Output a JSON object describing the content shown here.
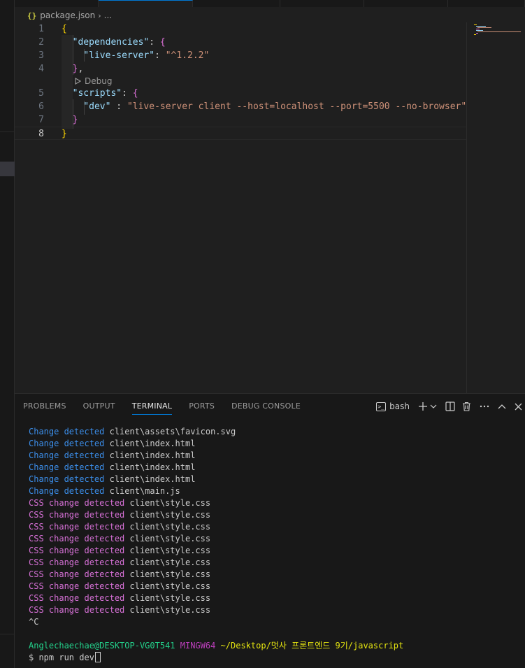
{
  "breadcrumb": {
    "file": "package.json",
    "icon": "{}",
    "more": "..."
  },
  "editor": {
    "codelens": "Debug",
    "lines": [
      {
        "n": "1",
        "tokens": [
          {
            "t": "{",
            "c": "t-brace-y"
          }
        ]
      },
      {
        "n": "2",
        "tokens": [
          {
            "t": "  \"dependencies\"",
            "c": "t-key"
          },
          {
            "t": ": ",
            "c": "t-punc"
          },
          {
            "t": "{",
            "c": "t-brace-p"
          }
        ]
      },
      {
        "n": "3",
        "tokens": [
          {
            "t": "    \"live-server\"",
            "c": "t-key"
          },
          {
            "t": ": ",
            "c": "t-punc"
          },
          {
            "t": "\"^1.2.2\"",
            "c": "t-str"
          }
        ]
      },
      {
        "n": "4",
        "tokens": [
          {
            "t": "  }",
            "c": "t-brace-p"
          },
          {
            "t": ",",
            "c": "t-punc"
          }
        ]
      },
      {
        "n": "5",
        "tokens": [
          {
            "t": "  \"scripts\"",
            "c": "t-key"
          },
          {
            "t": ": ",
            "c": "t-punc"
          },
          {
            "t": "{",
            "c": "t-brace-p"
          }
        ]
      },
      {
        "n": "6",
        "tokens": [
          {
            "t": "    \"dev\"",
            "c": "t-key"
          },
          {
            "t": " : ",
            "c": "t-punc"
          },
          {
            "t": "\"live-server client --host=localhost --port=5500 --no-browser\"",
            "c": "t-str"
          }
        ]
      },
      {
        "n": "7",
        "tokens": [
          {
            "t": "  }",
            "c": "t-brace-p"
          }
        ]
      },
      {
        "n": "8",
        "tokens": [
          {
            "t": "}",
            "c": "t-brace-y"
          }
        ]
      }
    ]
  },
  "panel": {
    "tabs": [
      "PROBLEMS",
      "OUTPUT",
      "TERMINAL",
      "PORTS",
      "DEBUG CONSOLE"
    ],
    "active_tab": "TERMINAL",
    "terminal_name": "bash"
  },
  "terminal": {
    "lines": [
      [
        {
          "t": "Change detected ",
          "c": "c-blue"
        },
        {
          "t": "client\\assets\\favicon.svg",
          "c": "c-white"
        }
      ],
      [
        {
          "t": "Change detected ",
          "c": "c-blue"
        },
        {
          "t": "client\\index.html",
          "c": "c-white"
        }
      ],
      [
        {
          "t": "Change detected ",
          "c": "c-blue"
        },
        {
          "t": "client\\index.html",
          "c": "c-white"
        }
      ],
      [
        {
          "t": "Change detected ",
          "c": "c-blue"
        },
        {
          "t": "client\\index.html",
          "c": "c-white"
        }
      ],
      [
        {
          "t": "Change detected ",
          "c": "c-blue"
        },
        {
          "t": "client\\index.html",
          "c": "c-white"
        }
      ],
      [
        {
          "t": "Change detected ",
          "c": "c-blue"
        },
        {
          "t": "client\\main.js",
          "c": "c-white"
        }
      ],
      [
        {
          "t": "CSS change detected ",
          "c": "c-mag"
        },
        {
          "t": "client\\style.css",
          "c": "c-white"
        }
      ],
      [
        {
          "t": "CSS change detected ",
          "c": "c-mag"
        },
        {
          "t": "client\\style.css",
          "c": "c-white"
        }
      ],
      [
        {
          "t": "CSS change detected ",
          "c": "c-mag"
        },
        {
          "t": "client\\style.css",
          "c": "c-white"
        }
      ],
      [
        {
          "t": "CSS change detected ",
          "c": "c-mag"
        },
        {
          "t": "client\\style.css",
          "c": "c-white"
        }
      ],
      [
        {
          "t": "CSS change detected ",
          "c": "c-mag"
        },
        {
          "t": "client\\style.css",
          "c": "c-white"
        }
      ],
      [
        {
          "t": "CSS change detected ",
          "c": "c-mag"
        },
        {
          "t": "client\\style.css",
          "c": "c-white"
        }
      ],
      [
        {
          "t": "CSS change detected ",
          "c": "c-mag"
        },
        {
          "t": "client\\style.css",
          "c": "c-white"
        }
      ],
      [
        {
          "t": "CSS change detected ",
          "c": "c-mag"
        },
        {
          "t": "client\\style.css",
          "c": "c-white"
        }
      ],
      [
        {
          "t": "CSS change detected ",
          "c": "c-mag"
        },
        {
          "t": "client\\style.css",
          "c": "c-white"
        }
      ],
      [
        {
          "t": "CSS change detected ",
          "c": "c-mag"
        },
        {
          "t": "client\\style.css",
          "c": "c-white"
        }
      ],
      [
        {
          "t": "^C",
          "c": "c-white"
        }
      ],
      [
        {
          "t": "",
          "c": "c-white"
        }
      ],
      [
        {
          "t": "Anglechaechae@DESKTOP-VG0T541 ",
          "c": "c-green"
        },
        {
          "t": "MINGW64 ",
          "c": "c-purple"
        },
        {
          "t": "~/Desktop/멋사 프론트엔드 9기/javascript",
          "c": "c-yellow"
        }
      ]
    ],
    "prompt": "$ npm run dev"
  },
  "colors": {
    "accent": "#0078d4",
    "background": "#1f1f1f",
    "panel": "#181818"
  }
}
